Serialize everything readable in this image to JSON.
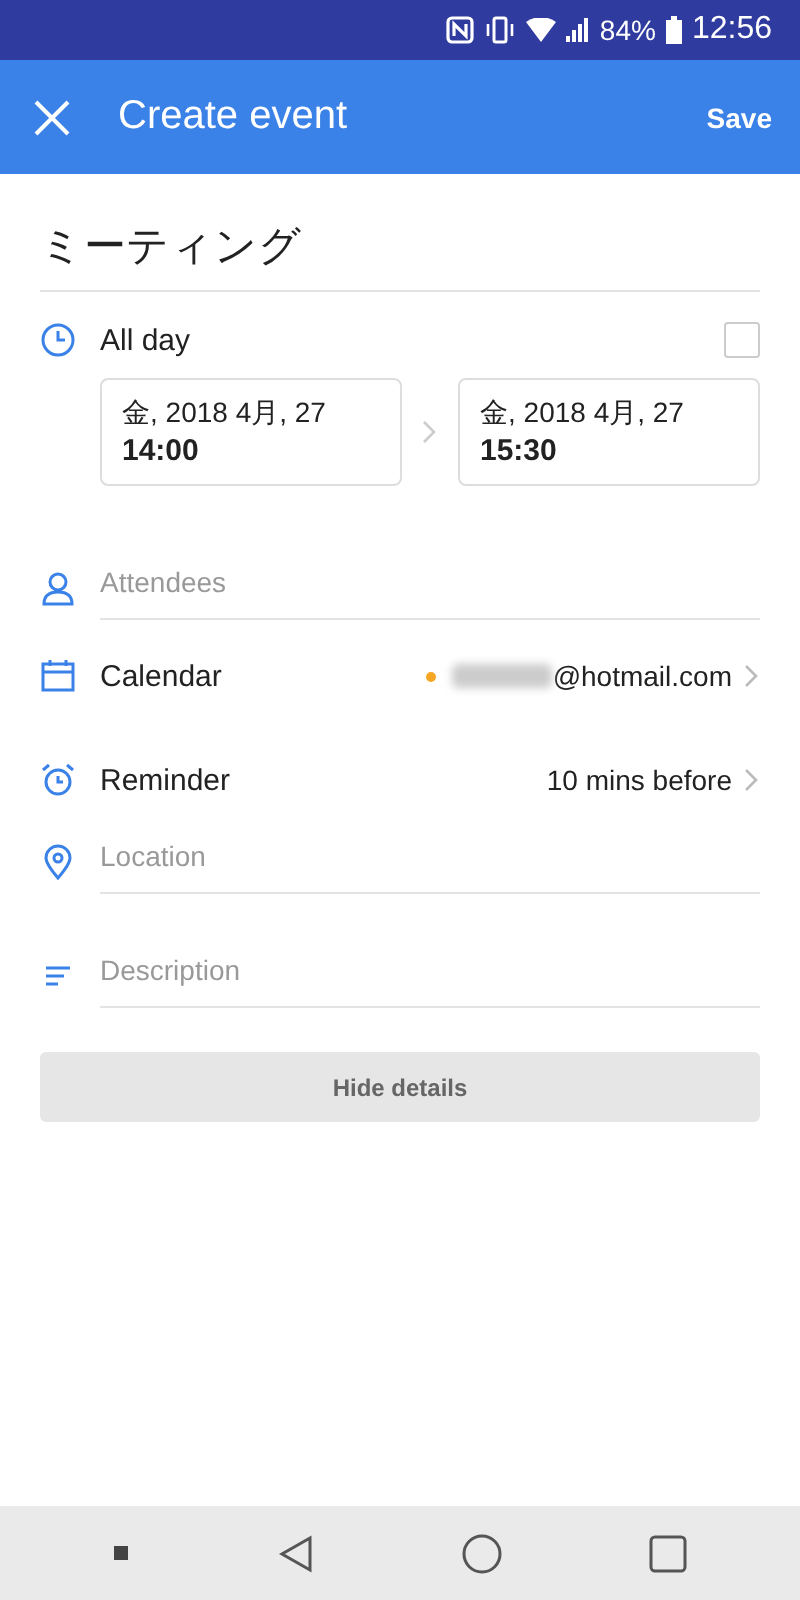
{
  "status_bar": {
    "battery": "84%",
    "time": "12:56"
  },
  "app_bar": {
    "title": "Create event",
    "action": "Save"
  },
  "event_title": "ミーティング",
  "all_day": {
    "label": "All day",
    "checked": false
  },
  "start": {
    "date": "金, 2018 4月, 27",
    "time": "14:00"
  },
  "end": {
    "date": "金, 2018 4月, 27",
    "time": "15:30"
  },
  "attendees": {
    "placeholder": "Attendees"
  },
  "calendar": {
    "label": "Calendar",
    "value": "@hotmail.com",
    "color": "#f5a623"
  },
  "reminder": {
    "label": "Reminder",
    "value": "10 mins before"
  },
  "location": {
    "placeholder": "Location"
  },
  "description": {
    "placeholder": "Description"
  },
  "hide_details": "Hide details"
}
